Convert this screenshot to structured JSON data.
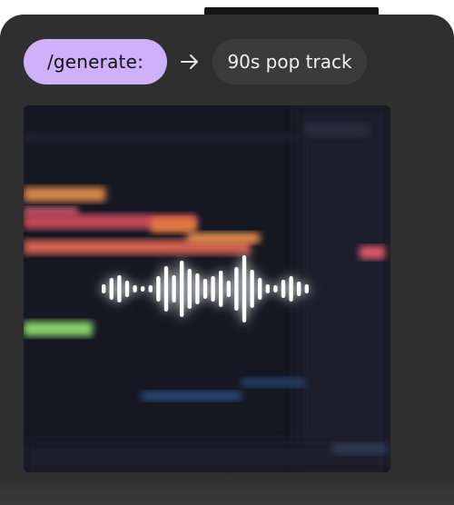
{
  "prompt": {
    "command": "/generate:",
    "query": "90s pop track"
  },
  "icons": {
    "arrow": "arrow-right-icon",
    "waveform": "audio-waveform-icon"
  },
  "colors": {
    "card": "#2f2f30",
    "command_pill": "#cfb0fb",
    "query_pill": "#3b3b3c",
    "waveform": "#ffffff"
  }
}
